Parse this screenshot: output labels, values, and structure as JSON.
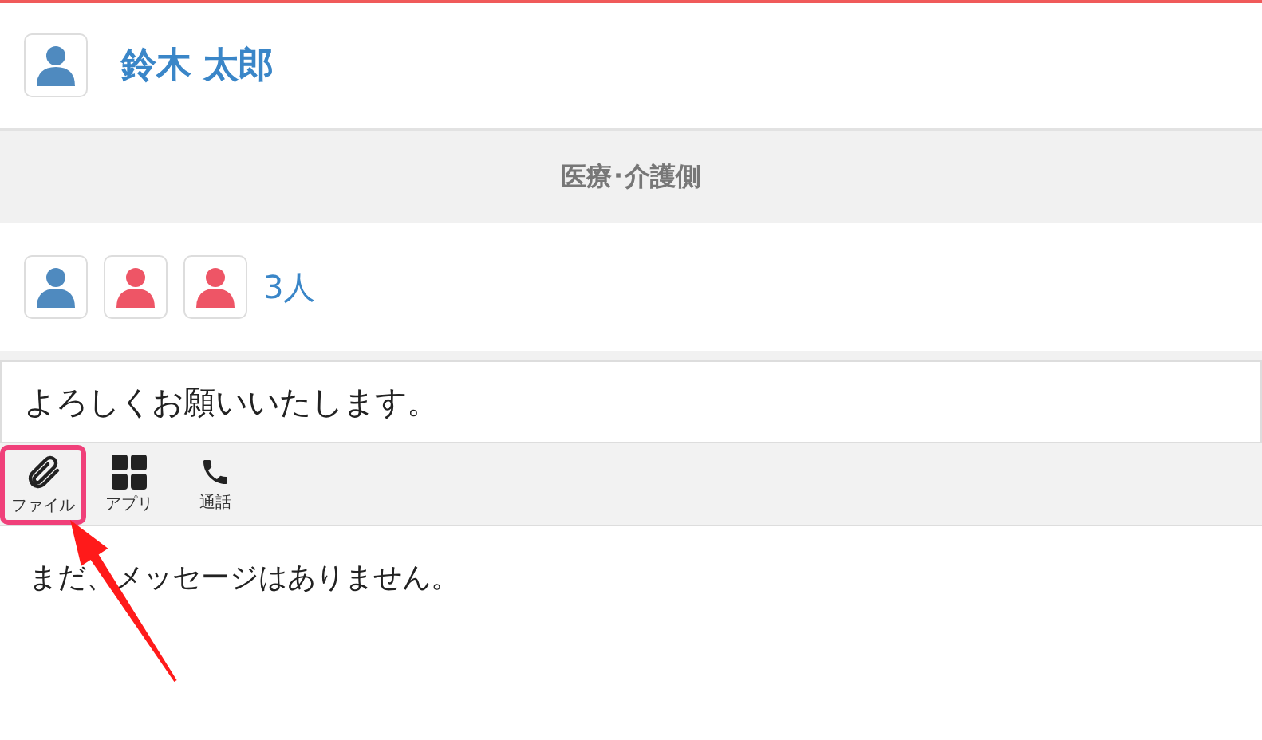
{
  "user": {
    "name": "鈴木 太郎",
    "color": "#4f8abf"
  },
  "section": {
    "title": "医療･介護側"
  },
  "members": {
    "avatars": [
      {
        "color": "#4f8abf"
      },
      {
        "color": "#ee5566"
      },
      {
        "color": "#ee5566"
      }
    ],
    "count": "3人"
  },
  "composer": {
    "value": "よろしくお願いいたします。"
  },
  "toolbar": [
    {
      "kind": "file",
      "label": "ファイル",
      "highlighted": true
    },
    {
      "kind": "apps",
      "label": "アプリ",
      "highlighted": false
    },
    {
      "kind": "call",
      "label": "通話",
      "highlighted": false
    }
  ],
  "messages": {
    "empty_text": "まだ、メッセージはありません。"
  }
}
